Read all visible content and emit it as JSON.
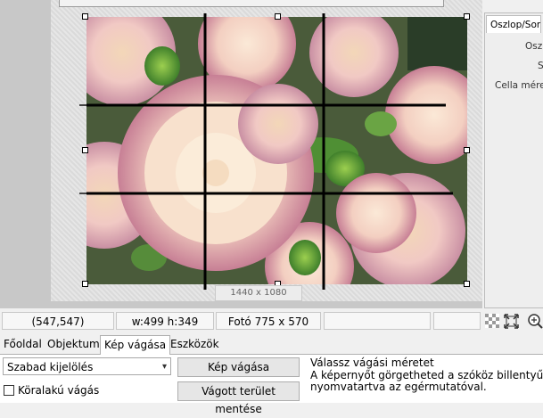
{
  "canvas": {
    "image_size_label": "1440 x 1080"
  },
  "right_panel": {
    "tab_label": "Oszlop/Sor",
    "labels": [
      "Oszlo",
      "S",
      "Cella méret"
    ]
  },
  "statusbar": {
    "position": "(547,547)",
    "selection": "w:499 h:349",
    "photo": "Fotó 775 x 570",
    "empty1": "",
    "empty2": ""
  },
  "tabs": [
    {
      "label": "Főoldal",
      "active": false
    },
    {
      "label": "Objektum",
      "active": false
    },
    {
      "label": "Kép vágása",
      "active": true
    },
    {
      "label": "Eszközök",
      "active": false
    }
  ],
  "toolpanel": {
    "select_value": "Szabad kijelölés",
    "crop_button": "Kép vágása",
    "save_button": "Vágott terület mentése",
    "circle_checkbox_label": "Köralakú vágás",
    "circle_checked": false,
    "info_lines": [
      "Válassz vágási méretet",
      "A képernyőt görgetheted a szóköz billentyűt",
      "nyomvatartva az egérmutatóval."
    ]
  },
  "icons": {
    "grid": "grid-icon",
    "fit": "fit-screen-icon",
    "zoom": "zoom-icon"
  },
  "colors": {
    "guide_lines": "#000000",
    "canvas_bg": "#c8c8c8"
  }
}
